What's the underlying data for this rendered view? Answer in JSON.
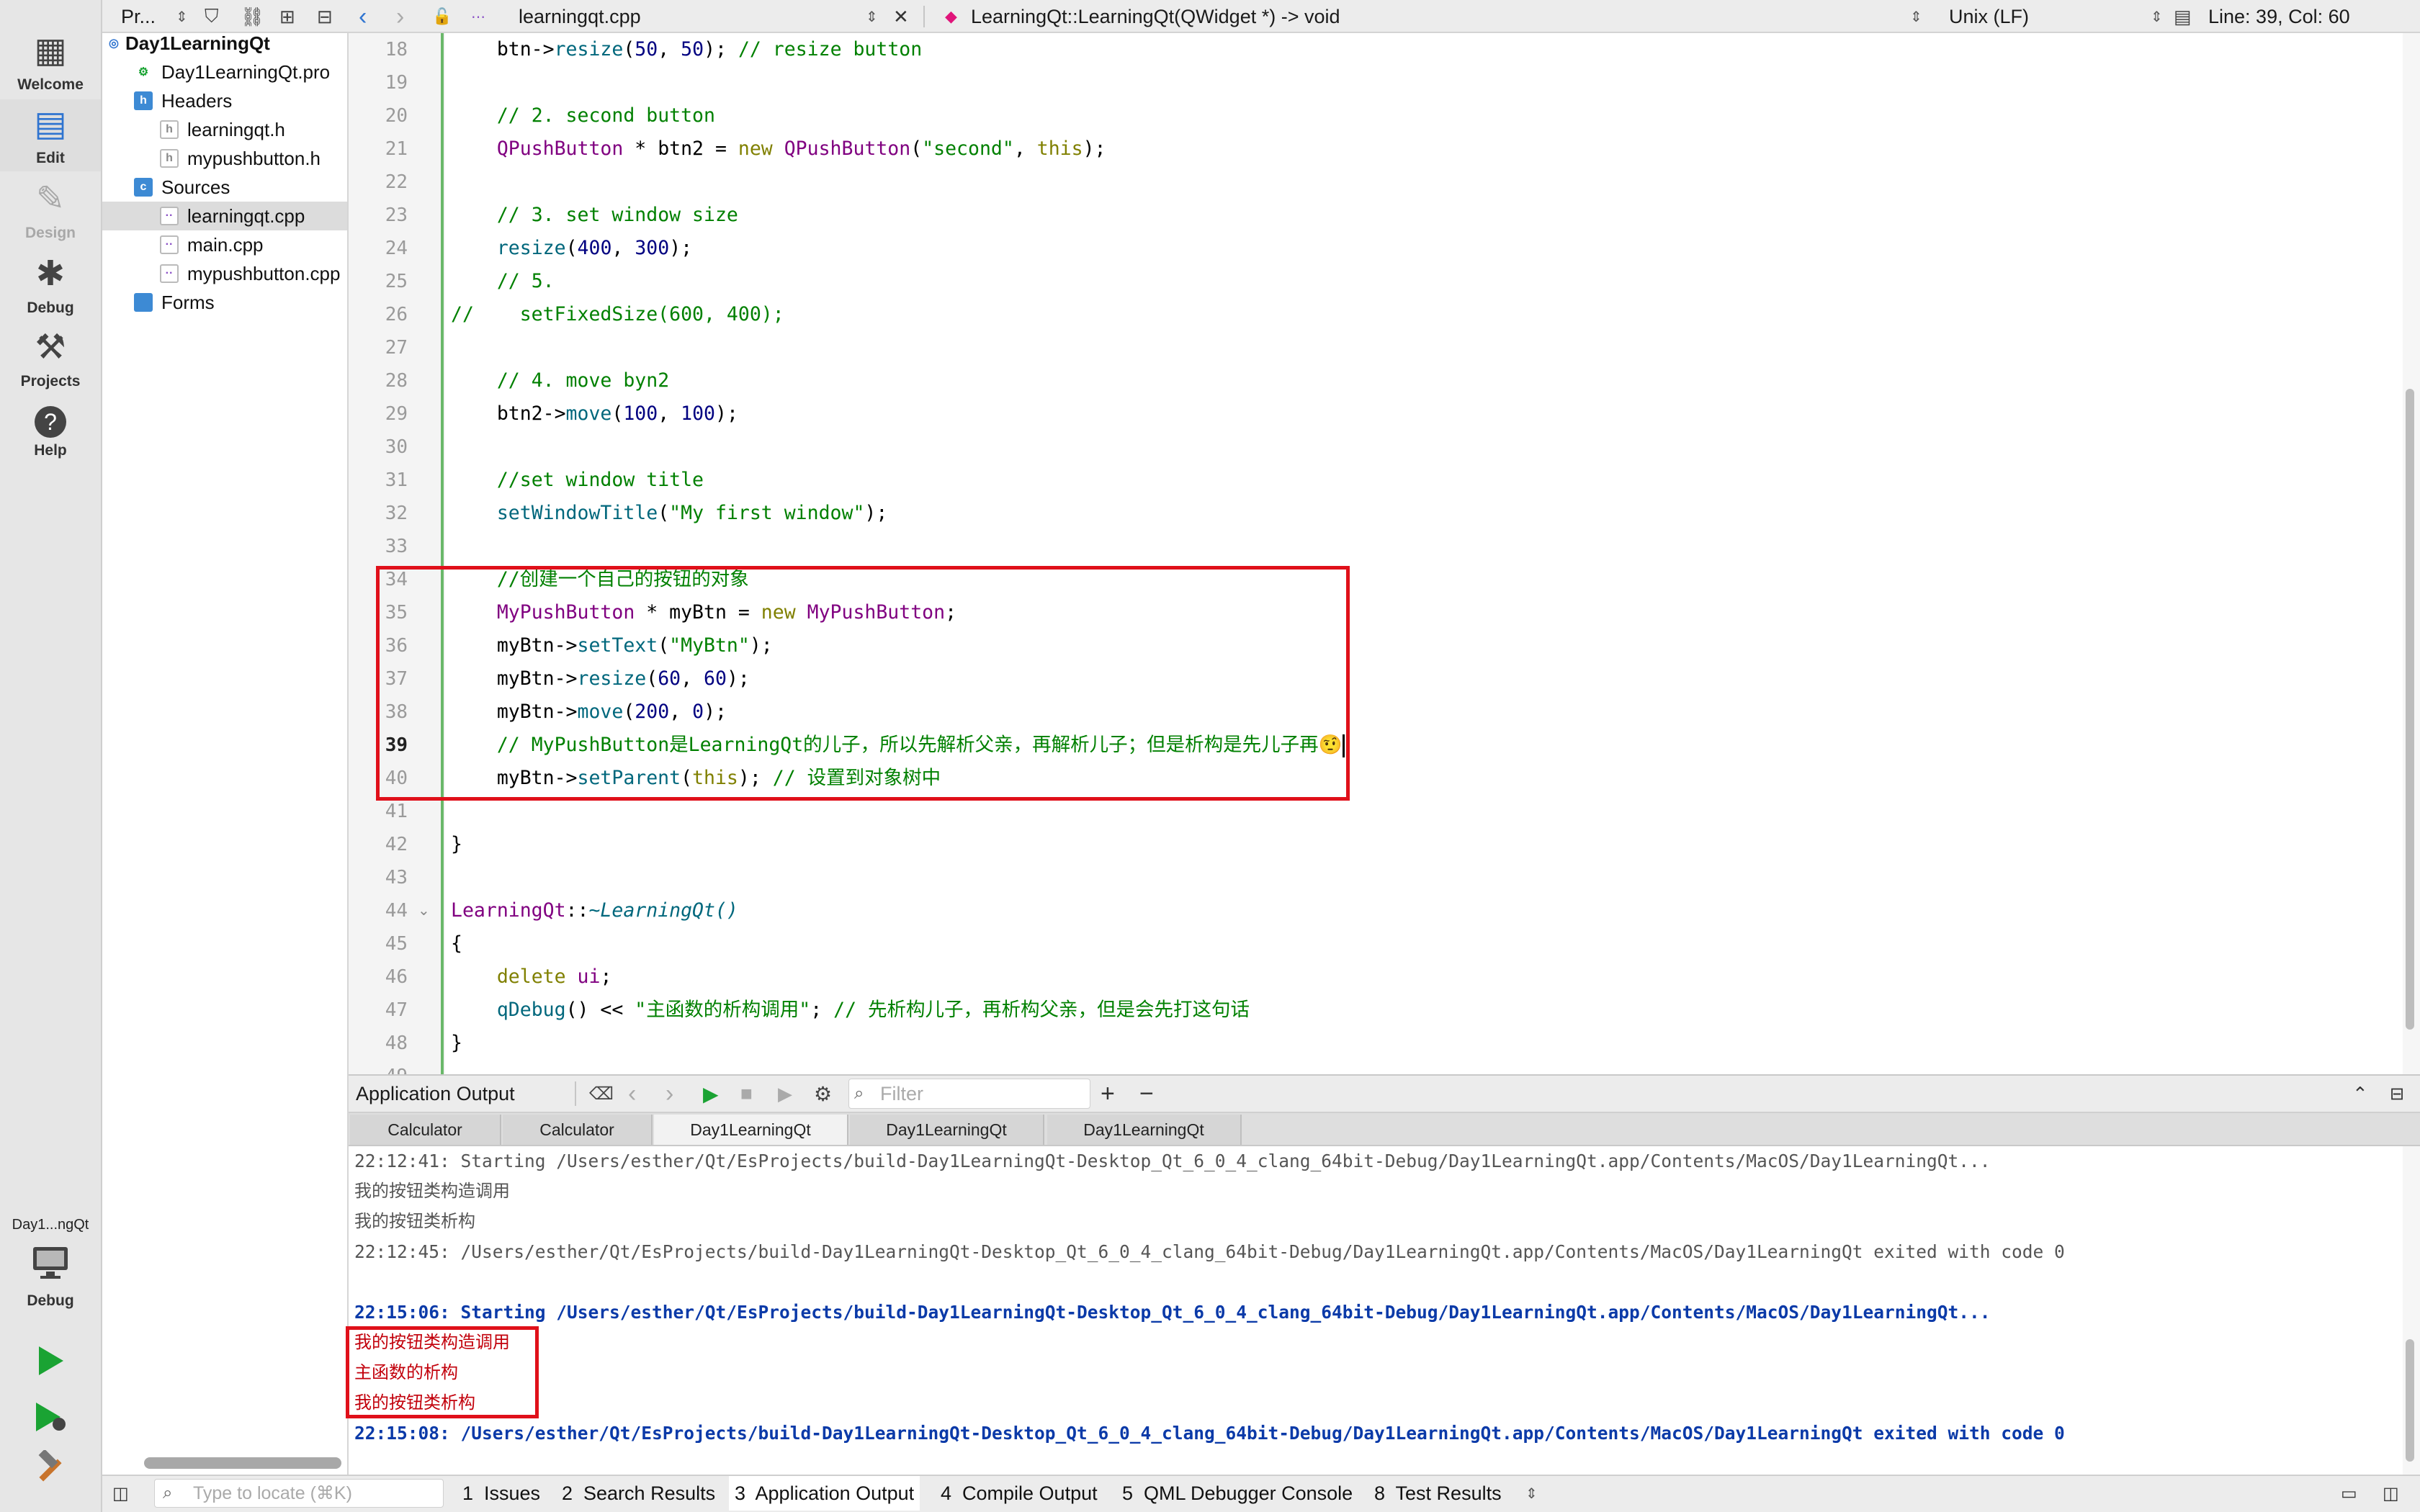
{
  "modes": [
    {
      "label": "Welcome",
      "icon": "grid-icon"
    },
    {
      "label": "Edit",
      "icon": "edit-icon"
    },
    {
      "label": "Design",
      "icon": "pencil-icon"
    },
    {
      "label": "Debug",
      "icon": "bug-icon"
    },
    {
      "label": "Projects",
      "icon": "wrench-icon"
    },
    {
      "label": "Help",
      "icon": "help-icon"
    }
  ],
  "kit": {
    "project": "Day1...ngQt",
    "mode": "Debug"
  },
  "tree_toolbar": {
    "selector": "Pr..."
  },
  "tree": [
    {
      "label": "Day1LearningQt",
      "kind": "project"
    },
    {
      "label": "Day1LearningQt.pro",
      "kind": "pro"
    },
    {
      "label": "Headers",
      "kind": "folder"
    },
    {
      "label": "learningqt.h",
      "kind": "h"
    },
    {
      "label": "mypushbutton.h",
      "kind": "h"
    },
    {
      "label": "Sources",
      "kind": "folder"
    },
    {
      "label": "learningqt.cpp",
      "kind": "cpp",
      "selected": true
    },
    {
      "label": "main.cpp",
      "kind": "cpp"
    },
    {
      "label": "mypushbutton.cpp",
      "kind": "cpp"
    },
    {
      "label": "Forms",
      "kind": "folder"
    }
  ],
  "editor": {
    "file": "learningqt.cpp",
    "symbol": "LearningQt::LearningQt(QWidget *) -> void",
    "line_ending": "Unix (LF)",
    "position": "Line: 39, Col: 60",
    "current_line": "39",
    "lines": [
      {
        "n": "18",
        "t": "    btn->resize(50, 50); // resize button"
      },
      {
        "n": "19",
        "t": ""
      },
      {
        "n": "20",
        "t": "    // 2. second button"
      },
      {
        "n": "21",
        "t": "    QPushButton * btn2 = new QPushButton(\"second\", this);"
      },
      {
        "n": "22",
        "t": ""
      },
      {
        "n": "23",
        "t": "    // 3. set window size"
      },
      {
        "n": "24",
        "t": "    resize(400, 300);"
      },
      {
        "n": "25",
        "t": "    // 5."
      },
      {
        "n": "26",
        "t": "//    setFixedSize(600, 400);"
      },
      {
        "n": "27",
        "t": ""
      },
      {
        "n": "28",
        "t": "    // 4. move byn2"
      },
      {
        "n": "29",
        "t": "    btn2->move(100, 100);"
      },
      {
        "n": "30",
        "t": ""
      },
      {
        "n": "31",
        "t": "    //set window title"
      },
      {
        "n": "32",
        "t": "    setWindowTitle(\"My first window\");"
      },
      {
        "n": "33",
        "t": ""
      },
      {
        "n": "34",
        "t": "    //创建一个自己的按钮的对象"
      },
      {
        "n": "35",
        "t": "    MyPushButton * myBtn = new MyPushButton;"
      },
      {
        "n": "36",
        "t": "    myBtn->setText(\"MyBtn\");"
      },
      {
        "n": "37",
        "t": "    myBtn->resize(60, 60);"
      },
      {
        "n": "38",
        "t": "    myBtn->move(200, 0);"
      },
      {
        "n": "39",
        "t": "    // MyPushButton是LearningQt的儿子，所以先解析父亲，再解析儿子；但是析构是先儿子再🤨"
      },
      {
        "n": "40",
        "t": "    myBtn->setParent(this); // 设置到对象树中"
      },
      {
        "n": "41",
        "t": ""
      },
      {
        "n": "42",
        "t": "}"
      },
      {
        "n": "43",
        "t": ""
      },
      {
        "n": "44",
        "t": "LearningQt::~LearningQt()"
      },
      {
        "n": "45",
        "t": "{"
      },
      {
        "n": "46",
        "t": "    delete ui;"
      },
      {
        "n": "47",
        "t": "    qDebug() << \"主函数的析构调用\"; // 先析构儿子，再析构父亲，但是会先打这句话"
      },
      {
        "n": "48",
        "t": "}"
      },
      {
        "n": "49",
        "t": ""
      }
    ]
  },
  "output": {
    "title": "Application Output",
    "filter_placeholder": "Filter",
    "tabs": [
      "Calculator",
      "Calculator",
      "Day1LearningQt",
      "Day1LearningQt",
      "Day1LearningQt"
    ],
    "active_tab": 2,
    "lines": [
      {
        "t": "22:12:41: Starting /Users/esther/Qt/EsProjects/build-Day1LearningQt-Desktop_Qt_6_0_4_clang_64bit-Debug/Day1LearningQt.app/Contents/MacOS/Day1LearningQt...",
        "s": "grey mono"
      },
      {
        "t": "我的按钮类构造调用",
        "s": "grey"
      },
      {
        "t": "我的按钮类析构",
        "s": "grey"
      },
      {
        "t": "22:12:45: /Users/esther/Qt/EsProjects/build-Day1LearningQt-Desktop_Qt_6_0_4_clang_64bit-Debug/Day1LearningQt.app/Contents/MacOS/Day1LearningQt exited with code 0",
        "s": "grey mono"
      },
      {
        "t": "",
        "s": "grey"
      },
      {
        "t": "22:15:06: Starting /Users/esther/Qt/EsProjects/build-Day1LearningQt-Desktop_Qt_6_0_4_clang_64bit-Debug/Day1LearningQt.app/Contents/MacOS/Day1LearningQt...",
        "s": "blue mono"
      },
      {
        "t": "我的按钮类构造调用",
        "s": "red"
      },
      {
        "t": "主函数的析构",
        "s": "red"
      },
      {
        "t": "我的按钮类析构",
        "s": "red"
      },
      {
        "t": "22:15:08: /Users/esther/Qt/EsProjects/build-Day1LearningQt-Desktop_Qt_6_0_4_clang_64bit-Debug/Day1LearningQt.app/Contents/MacOS/Day1LearningQt exited with code 0",
        "s": "blue mono"
      }
    ]
  },
  "statusbar": {
    "locate_placeholder": "Type to locate (⌘K)",
    "panes": [
      "1  Issues",
      "2  Search Results",
      "3  Application Output",
      "4  Compile Output",
      "5  QML Debugger Console",
      "8  Test Results"
    ]
  },
  "colors": {
    "accent": "#2f74d0",
    "highlight": "#e0101a",
    "run": "#1aa333"
  }
}
